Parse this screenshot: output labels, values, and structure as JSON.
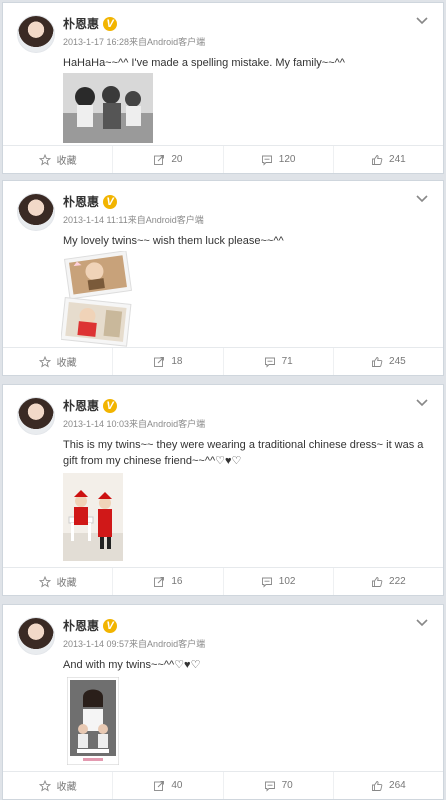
{
  "posts": [
    {
      "author": "朴恩惠",
      "verified_badge": "V",
      "meta": "2013-1-17 16:28来自Android客户端",
      "text": "HaHaHa~~^^ I've made a spelling mistake.  My family~~^^",
      "actions": {
        "favorite": "收藏",
        "repost": "20",
        "comment": "120",
        "like": "241"
      }
    },
    {
      "author": "朴恩惠",
      "verified_badge": "V",
      "meta": "2013-1-14 11:11来自Android客户端",
      "text": "My lovely twins~~ wish them luck please~~^^",
      "actions": {
        "favorite": "收藏",
        "repost": "18",
        "comment": "71",
        "like": "245"
      }
    },
    {
      "author": "朴恩惠",
      "verified_badge": "V",
      "meta": "2013-1-14 10:03来自Android客户端",
      "text": "This is my twins~~ they were wearing a traditional chinese dress~ it was a gift from my chinese friend~~^^♡♥♡",
      "actions": {
        "favorite": "收藏",
        "repost": "16",
        "comment": "102",
        "like": "222"
      }
    },
    {
      "author": "朴恩惠",
      "verified_badge": "V",
      "meta": "2013-1-14 09:57来自Android客户端",
      "text": "And with my twins~~^^♡♥♡",
      "actions": {
        "favorite": "收藏",
        "repost": "40",
        "comment": "70",
        "like": "264"
      }
    }
  ],
  "icons": {
    "favorite": "star-icon",
    "repost": "repost-icon",
    "comment": "comment-icon",
    "like": "thumbs-up-icon",
    "menu": "chevron-down-icon"
  },
  "colors": {
    "background": "#dfe3e8",
    "card": "#ffffff",
    "meta_text": "#8a8a8a",
    "verified": "#f2b400",
    "action_text": "#777777"
  }
}
